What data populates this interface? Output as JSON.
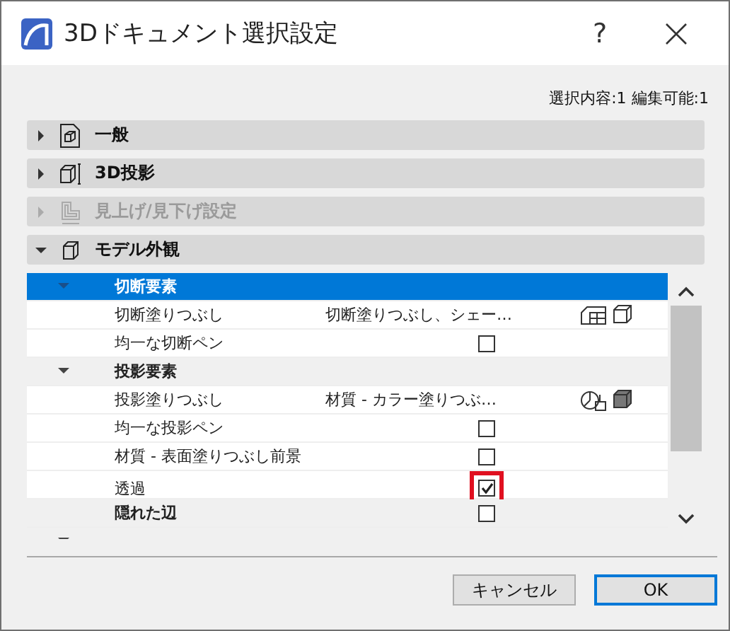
{
  "window": {
    "title": "3Dドキュメント選択設定",
    "help": "?"
  },
  "selection_info": "選択内容:1 編集可能:1",
  "sections": [
    {
      "label": "一般",
      "expanded": false,
      "disabled": false
    },
    {
      "label": "3D投影",
      "expanded": false,
      "disabled": false
    },
    {
      "label": "見上げ/見下げ設定",
      "expanded": false,
      "disabled": true
    },
    {
      "label": "モデル外観",
      "expanded": true,
      "disabled": false
    }
  ],
  "table": {
    "rows": [
      {
        "kind": "group",
        "label": "切断要素",
        "selected": true,
        "expanded": true
      },
      {
        "kind": "value",
        "label": "切断塗りつぶし",
        "value": "切断塗りつぶし、シェー…"
      },
      {
        "kind": "check",
        "label": "均一な切断ペン",
        "checked": false,
        "highlighted": false
      },
      {
        "kind": "group",
        "label": "投影要素",
        "selected": false,
        "expanded": true
      },
      {
        "kind": "value",
        "label": "投影塗りつぶし",
        "value": "材質 - カラー塗りつぶ…"
      },
      {
        "kind": "check",
        "label": "均一な投影ペン",
        "checked": false,
        "highlighted": false
      },
      {
        "kind": "check",
        "label": "材質 - 表面塗りつぶし前景",
        "checked": false,
        "highlighted": false
      },
      {
        "kind": "check",
        "label": "透過",
        "checked": true,
        "highlighted": true
      },
      {
        "kind": "group-check",
        "label": "隠れた辺",
        "checked": false
      },
      {
        "kind": "group",
        "selected": false,
        "expanded": true
      }
    ]
  },
  "buttons": [
    {
      "label": "キャンセル",
      "default": false
    },
    {
      "label": "OK",
      "default": true
    }
  ]
}
